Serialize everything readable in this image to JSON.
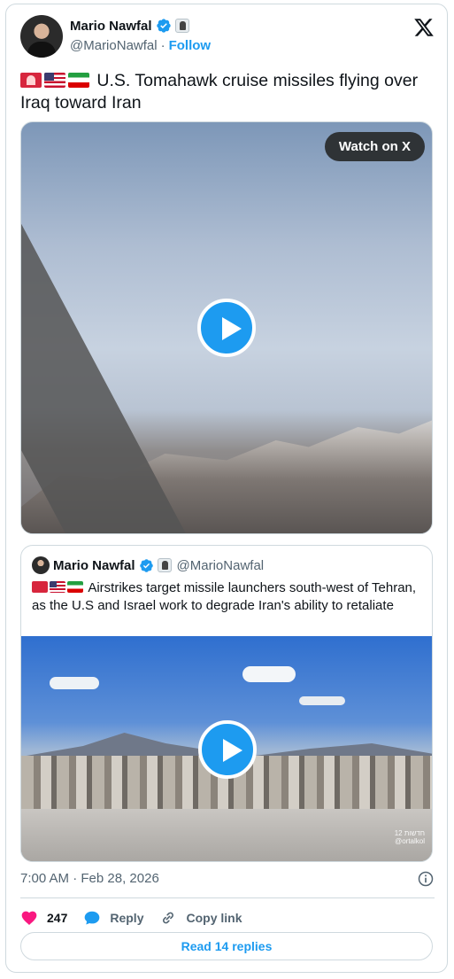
{
  "author": {
    "name": "Mario Nawfal",
    "handle": "@MarioNawfal",
    "separator": "·",
    "follow_label": "Follow"
  },
  "tweet": {
    "text": "U.S. Tomahawk cruise missiles flying over Iraq toward Iran",
    "emoji": [
      "siren",
      "flag-us",
      "flag-iran"
    ]
  },
  "media": {
    "watch_label": "Watch on X"
  },
  "quote": {
    "name": "Mario Nawfal",
    "handle": "@MarioNawfal",
    "text": "Airstrikes target missile launchers south-west of Tehran, as the U.S and Israel work to degrade Iran's ability to retaliate",
    "watermark_line1": "חדשות 12",
    "watermark_line2": "@ortalkol"
  },
  "meta": {
    "time": "7:00 AM",
    "separator": "·",
    "date": "Feb 28, 2026"
  },
  "actions": {
    "likes": "247",
    "reply_label": "Reply",
    "copy_label": "Copy link"
  },
  "read_replies_label": "Read 14 replies",
  "colors": {
    "accent": "#1d9bf0",
    "like": "#f91880",
    "muted": "#536471",
    "border": "#cfd9de"
  },
  "icons": [
    "verified-badge-icon",
    "affiliate-badge-icon",
    "x-logo-icon",
    "play-icon",
    "info-icon",
    "heart-icon",
    "reply-bubble-icon",
    "link-icon"
  ]
}
